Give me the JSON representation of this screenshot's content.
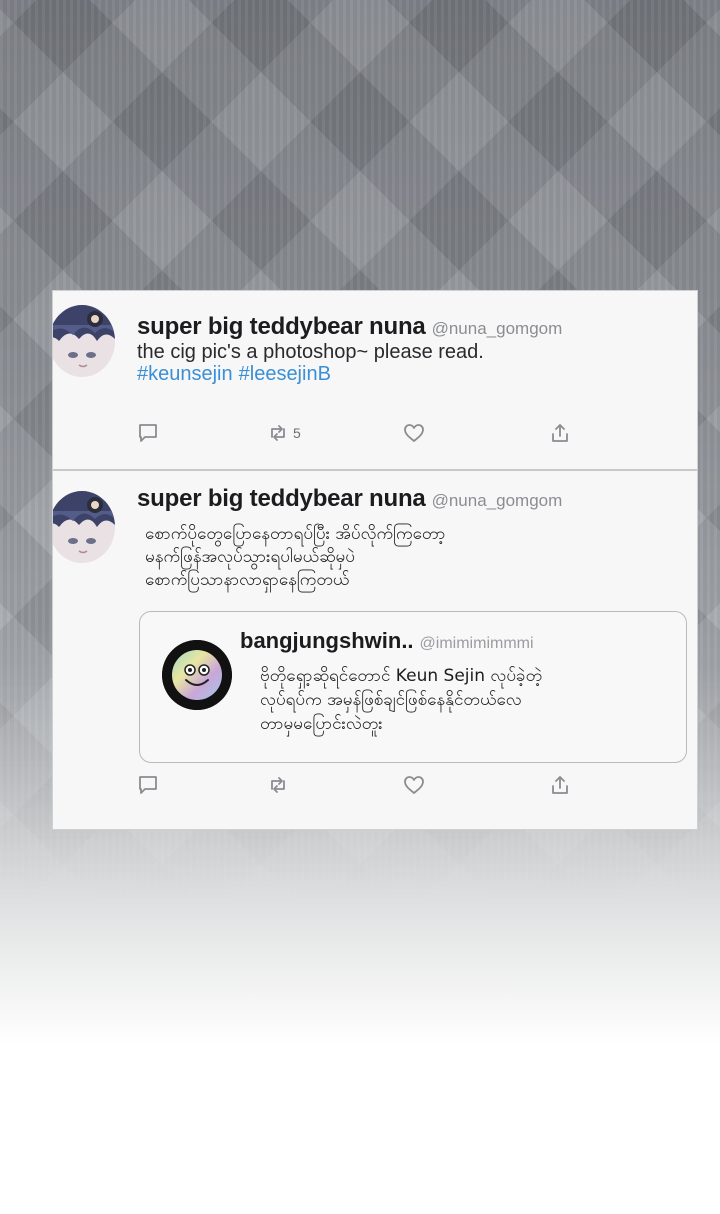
{
  "tweets": [
    {
      "display_name": "super big teddybear nuna",
      "handle": "@nuna_gomgom",
      "text": "the cig pic's a photoshop~ please read.",
      "hashtags": [
        "#keunsejin",
        "#leesejinB"
      ],
      "retweet_count": "5",
      "icons": [
        "reply-icon",
        "retweet-icon",
        "like-icon",
        "share-icon"
      ]
    },
    {
      "display_name": "super big teddybear nuna",
      "handle": "@nuna_gomgom",
      "text_lines": [
        "စောက်ပိုတွေပြောနေတာရပ်ပြီး အိပ်လိုက်ကြတော့",
        "မနက်ဖြန်အလုပ်သွားရပါမယ်ဆိုမှပဲ",
        "စောက်ပြသာနာလာရှာနေကြတယ်"
      ],
      "quoted": {
        "display_name": "bangjungshwin..",
        "handle": "@imimimimmmi",
        "text_lines": [
          "ဗိုတိုရှော့ဆိုရင်တောင် Keun Sejin လုပ်ခဲ့တဲ့",
          "လုပ်ရပ်က အမှန်ဖြစ်ချင်ဖြစ်နေနိုင်တယ်လေ",
          "တာမှမပြောင်းလဲတူး"
        ]
      },
      "icons": [
        "reply-icon",
        "retweet-icon",
        "like-icon",
        "share-icon"
      ]
    }
  ]
}
